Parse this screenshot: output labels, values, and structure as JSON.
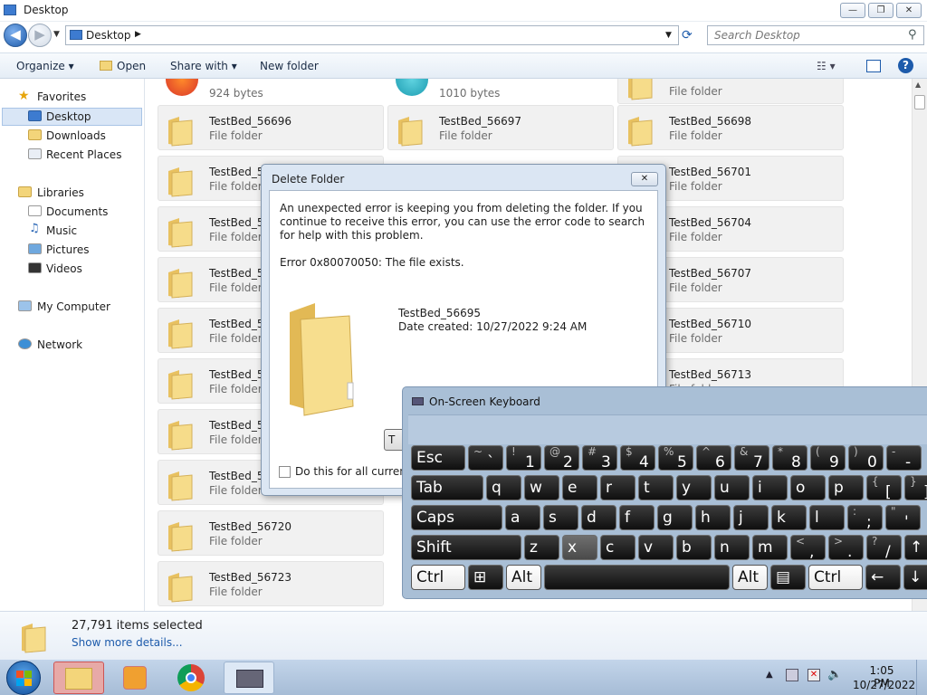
{
  "window": {
    "title": "Desktop",
    "min_label": "▭",
    "max_label": "⧉",
    "close_label": "✕"
  },
  "address": {
    "path": "Desktop",
    "search_placeholder": "Search Desktop"
  },
  "commands": {
    "organize": "Organize",
    "open": "Open",
    "share_with": "Share with",
    "new_folder": "New folder"
  },
  "nav": {
    "favorites": "Favorites",
    "desktop": "Desktop",
    "downloads": "Downloads",
    "recent": "Recent Places",
    "libraries": "Libraries",
    "documents": "Documents",
    "music": "Music",
    "pictures": "Pictures",
    "videos": "Videos",
    "computer": "My Computer",
    "network": "Network"
  },
  "files": {
    "top_partial": [
      {
        "size": "924 bytes"
      },
      {
        "size": "1010 bytes"
      },
      {
        "type": "File folder"
      }
    ],
    "folder_type": "File folder",
    "col1": [
      "TestBed_56696",
      "TestBed_56",
      "TestBed_56",
      "TestBed_56",
      "TestBed_56",
      "TestBed_56",
      "TestBed_56",
      "TestBed_56",
      "TestBed_56720",
      "TestBed_56723"
    ],
    "col2": [
      "TestBed_56697"
    ],
    "col3": [
      "TestBed_56698",
      "TestBed_56701",
      "TestBed_56704",
      "TestBed_56707",
      "TestBed_56710",
      "TestBed_56713"
    ]
  },
  "status": {
    "selected": "27,791 items selected",
    "more": "Show more details..."
  },
  "dialog": {
    "title": "Delete Folder",
    "message": "An unexpected error is keeping you from deleting the folder. If you continue to receive this error, you can use the error code to search for help with this problem.",
    "error": "Error 0x80070050: The file exists.",
    "item_name": "TestBed_56695",
    "item_date": "Date created: 10/27/2022 9:24 AM",
    "checkbox_label": "Do this for all current it",
    "button_partial": "T"
  },
  "osk": {
    "title": "On-Screen Keyboard",
    "row1": [
      {
        "m": "Esc"
      },
      {
        "t": "~",
        "b": "`"
      },
      {
        "t": "!",
        "b": "1"
      },
      {
        "t": "@",
        "b": "2"
      },
      {
        "t": "#",
        "b": "3"
      },
      {
        "t": "$",
        "b": "4"
      },
      {
        "t": "%",
        "b": "5"
      },
      {
        "t": "^",
        "b": "6"
      },
      {
        "t": "&",
        "b": "7"
      },
      {
        "t": "*",
        "b": "8"
      },
      {
        "t": "(",
        "b": "9"
      },
      {
        "t": ")",
        "b": "0"
      },
      {
        "t": "-",
        "b": "-"
      }
    ],
    "row2": [
      {
        "m": "Tab"
      },
      {
        "m": "q"
      },
      {
        "m": "w"
      },
      {
        "m": "e"
      },
      {
        "m": "r"
      },
      {
        "m": "t"
      },
      {
        "m": "y"
      },
      {
        "m": "u"
      },
      {
        "m": "i"
      },
      {
        "m": "o"
      },
      {
        "m": "p"
      },
      {
        "t": "{",
        "b": "["
      },
      {
        "t": "}",
        "b": "]"
      }
    ],
    "row3": [
      {
        "m": "Caps"
      },
      {
        "m": "a"
      },
      {
        "m": "s"
      },
      {
        "m": "d"
      },
      {
        "m": "f"
      },
      {
        "m": "g"
      },
      {
        "m": "h"
      },
      {
        "m": "j"
      },
      {
        "m": "k"
      },
      {
        "m": "l"
      },
      {
        "t": ":",
        "b": ";"
      },
      {
        "t": "\"",
        "b": "'"
      }
    ],
    "row4": [
      {
        "m": "Shift"
      },
      {
        "m": "z"
      },
      {
        "m": "x"
      },
      {
        "m": "c"
      },
      {
        "m": "v"
      },
      {
        "m": "b"
      },
      {
        "m": "n"
      },
      {
        "m": "m"
      },
      {
        "t": "<",
        "b": ","
      },
      {
        "t": ">",
        "b": "."
      },
      {
        "t": "?",
        "b": "/"
      },
      {
        "m": "↑"
      }
    ],
    "row5": [
      {
        "m": "Ctrl"
      },
      {
        "m": "⊞"
      },
      {
        "m": "Alt"
      },
      {
        "m": ""
      },
      {
        "m": "Alt"
      },
      {
        "m": "▤"
      },
      {
        "m": "Ctrl"
      },
      {
        "m": "←"
      },
      {
        "m": "↓"
      }
    ]
  },
  "taskbar": {
    "time": "1:05 PM",
    "date": "10/27/2022"
  },
  "colors": {
    "folder": "#f3d57a",
    "accent": "#1d5bab"
  }
}
